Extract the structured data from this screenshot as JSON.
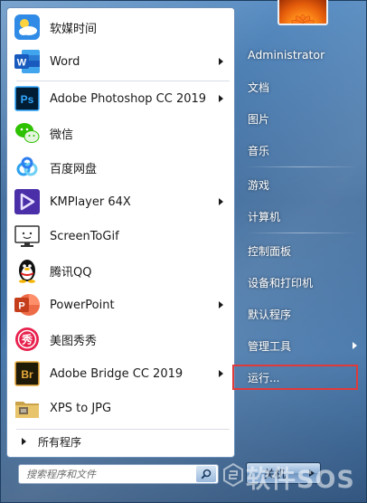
{
  "programs": [
    {
      "label": "软媒时间",
      "icon": "weather-clock-icon",
      "has_submenu": false
    },
    {
      "label": "Word",
      "icon": "word-icon",
      "has_submenu": true
    },
    {
      "label": "Adobe Photoshop CC 2019",
      "icon": "photoshop-icon",
      "has_submenu": true
    },
    {
      "label": "微信",
      "icon": "wechat-icon",
      "has_submenu": false
    },
    {
      "label": "百度网盘",
      "icon": "baidu-netdisk-icon",
      "has_submenu": false
    },
    {
      "label": "KMPlayer 64X",
      "icon": "kmplayer-icon",
      "has_submenu": true
    },
    {
      "label": "ScreenToGif",
      "icon": "screentogif-icon",
      "has_submenu": false
    },
    {
      "label": "腾讯QQ",
      "icon": "qq-penguin-icon",
      "has_submenu": false
    },
    {
      "label": "PowerPoint",
      "icon": "powerpoint-icon",
      "has_submenu": true
    },
    {
      "label": "美图秀秀",
      "icon": "meitu-icon",
      "has_submenu": false
    },
    {
      "label": "Adobe Bridge CC 2019",
      "icon": "bridge-icon",
      "has_submenu": true
    },
    {
      "label": "XPS to JPG",
      "icon": "folder-icon",
      "has_submenu": false
    }
  ],
  "all_programs_label": "所有程序",
  "search": {
    "placeholder": "搜索程序和文件"
  },
  "right_menu": {
    "user": "Administrator",
    "documents": "文档",
    "pictures": "图片",
    "music": "音乐",
    "games": "游戏",
    "computer": "计算机",
    "control_panel": "控制面板",
    "devices_printers": "设备和打印机",
    "default_programs": "默认程序",
    "admin_tools": "管理工具",
    "run": "运行..."
  },
  "shutdown_label": "关机",
  "watermark": "软件SOS",
  "colors": {
    "highlight_border": "#e03a3a"
  }
}
